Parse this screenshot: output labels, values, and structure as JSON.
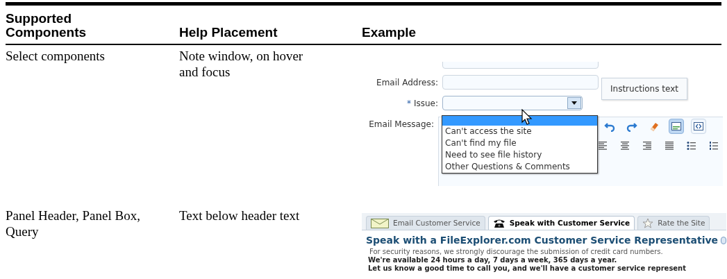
{
  "table": {
    "columns": [
      "Supported Components",
      "Help Placement",
      "Example"
    ],
    "rows": [
      {
        "component": "Select components",
        "placement": "Note window, on hover and focus",
        "example": {
          "kind": "select_form",
          "fields": [
            {
              "label": "Email Address:",
              "kind": "text"
            },
            {
              "label": "Issue:",
              "required_mark": "*",
              "kind": "select",
              "expanded": true
            },
            {
              "label": "Email Message:",
              "kind": "editor"
            }
          ],
          "note_window": "Instructions text",
          "options": [
            {
              "selected": true
            },
            {
              "label": "Can't access the site",
              "selected": false
            },
            {
              "label": "Can't find my file",
              "selected": false
            },
            {
              "label": "Need to see file history",
              "selected": false
            },
            {
              "label": "Other Questions & Comments",
              "selected": false
            }
          ],
          "toolbar": [
            {
              "kind": "undo"
            },
            {
              "kind": "redo"
            },
            {
              "kind": "eraser"
            },
            {
              "kind": "design-view",
              "selected": true
            },
            {
              "kind": "source-view",
              "selected": false
            }
          ],
          "format_bar": [
            {
              "kind": "align-left"
            },
            {
              "kind": "align-center"
            },
            {
              "kind": "align-right"
            },
            {
              "kind": "justify"
            },
            {
              "kind": "bullet-list"
            },
            {
              "kind": "numbered-list"
            }
          ]
        }
      },
      {
        "component": "Panel Header, Panel Box, Query",
        "placement": "Text below header text",
        "example": {
          "kind": "panel",
          "tabs": [
            {
              "label": "Email Customer Service",
              "kind": "envelope",
              "selected": false
            },
            {
              "label": "Speak with Customer Service",
              "kind": "phone",
              "selected": true
            },
            {
              "label": "Rate the Site",
              "kind": "star",
              "selected": false
            }
          ],
          "heading": "Speak with a FileExplorer.com Customer Service Representative",
          "lines": [
            {
              "text": "For security reasons, we strongly discourage the submission of credit card numbers.",
              "bold": false
            },
            {
              "text": "We're available 24 hours a day, 7 days a week, 365 days a year.",
              "bold": true
            },
            {
              "text": "Let us know a good time to call you, and we'll have a customer service represent",
              "bold": true
            }
          ]
        }
      }
    ]
  }
}
